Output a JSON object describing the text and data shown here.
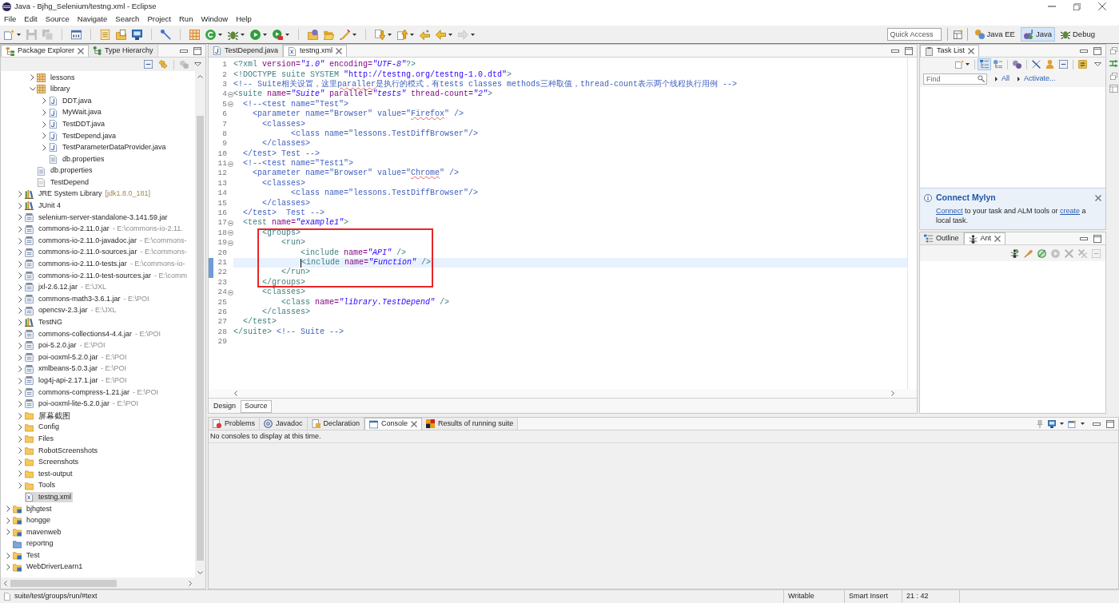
{
  "window": {
    "title": "Java - Bjhg_Selenium/testng.xml - Eclipse"
  },
  "menu": [
    "File",
    "Edit",
    "Source",
    "Navigate",
    "Search",
    "Project",
    "Run",
    "Window",
    "Help"
  ],
  "toolbar": {
    "groups": [
      [
        {
          "kind": "new",
          "dropdown": true,
          "disabled": false
        },
        {
          "kind": "save",
          "dropdown": false,
          "disabled": true
        },
        {
          "kind": "save-all",
          "dropdown": false,
          "disabled": true
        }
      ],
      [
        {
          "kind": "binary",
          "dropdown": false,
          "disabled": false
        }
      ],
      [
        {
          "kind": "list",
          "dropdown": false,
          "disabled": false
        },
        {
          "kind": "note",
          "dropdown": false,
          "disabled": false
        },
        {
          "kind": "monitor",
          "dropdown": false,
          "disabled": false
        }
      ],
      [
        {
          "kind": "slash",
          "dropdown": false,
          "disabled": false
        }
      ],
      [
        {
          "kind": "grid",
          "dropdown": false,
          "disabled": false
        },
        {
          "kind": "cycle",
          "dropdown": true,
          "disabled": false
        },
        {
          "kind": "bug",
          "dropdown": true,
          "disabled": false
        },
        {
          "kind": "run",
          "dropdown": true,
          "disabled": false
        },
        {
          "kind": "run-tool",
          "dropdown": true,
          "disabled": false
        }
      ],
      [
        {
          "kind": "folder-globe",
          "dropdown": false,
          "disabled": false
        },
        {
          "kind": "open-folder",
          "dropdown": false,
          "disabled": false
        },
        {
          "kind": "brush",
          "dropdown": true,
          "disabled": false
        }
      ],
      [
        {
          "kind": "down",
          "dropdown": true,
          "disabled": false
        },
        {
          "kind": "up",
          "dropdown": true,
          "disabled": false
        },
        {
          "kind": "last-edit",
          "dropdown": false,
          "disabled": false
        },
        {
          "kind": "back",
          "dropdown": true,
          "disabled": false
        },
        {
          "kind": "forward",
          "dropdown": true,
          "disabled": true
        }
      ]
    ],
    "quick_access": {
      "placeholder": "Quick Access"
    },
    "perspectives": [
      {
        "kind": "java-ee",
        "label": "Java EE",
        "selected": false
      },
      {
        "kind": "java",
        "label": "Java",
        "selected": true
      },
      {
        "kind": "debug",
        "label": "Debug",
        "selected": false
      }
    ]
  },
  "package_explorer": {
    "tabs": [
      {
        "kind": "explorer",
        "label": "Package Explorer",
        "selected": true
      },
      {
        "kind": "hierarchy",
        "label": "Type Hierarchy",
        "selected": false
      }
    ],
    "tree": [
      {
        "children": [
          {
            "children": [
              {
                "kind": "package",
                "label": "lessons",
                "expanded": false,
                "selected": false
              },
              {
                "kind": "package",
                "label": "library",
                "expanded": true,
                "selected": false,
                "children": [
                  {
                    "kind": "java",
                    "label": "DDT.java",
                    "expanded": false,
                    "selected": false
                  },
                  {
                    "kind": "java",
                    "label": "MyWait.java",
                    "expanded": false,
                    "selected": false
                  },
                  {
                    "kind": "java",
                    "label": "TestDDT.java",
                    "expanded": false,
                    "selected": false
                  },
                  {
                    "kind": "java",
                    "label": "TestDepend.java",
                    "expanded": false,
                    "selected": false
                  },
                  {
                    "kind": "java",
                    "label": "TestParameterDataProvider.java",
                    "expanded": false,
                    "selected": false
                  },
                  {
                    "kind": "properties",
                    "label": "db.properties",
                    "selected": false
                  }
                ]
              },
              {
                "kind": "properties",
                "label": "db.properties",
                "selected": false
              },
              {
                "kind": "file",
                "label": "TestDepend",
                "selected": false
              }
            ]
          },
          {
            "kind": "library",
            "label": "JRE System Library",
            "qualifier": "[jdk1.8.0_181]",
            "expanded": false,
            "selected": false
          },
          {
            "kind": "library",
            "label": "JUnit 4",
            "expanded": false,
            "selected": false
          },
          {
            "kind": "jar",
            "label": "selenium-server-standalone-3.141.59.jar",
            "expanded": false,
            "selected": false
          },
          {
            "kind": "jar",
            "label": "commons-io-2.11.0.jar",
            "detail": "- E:\\commons-io-2.11.",
            "expanded": false,
            "selected": false
          },
          {
            "kind": "jar",
            "label": "commons-io-2.11.0-javadoc.jar",
            "detail": "- E:\\commons-",
            "expanded": false,
            "selected": false
          },
          {
            "kind": "jar",
            "label": "commons-io-2.11.0-sources.jar",
            "detail": "- E:\\commons-",
            "expanded": false,
            "selected": false
          },
          {
            "kind": "jar",
            "label": "commons-io-2.11.0-tests.jar",
            "detail": "- E:\\commons-io-",
            "expanded": false,
            "selected": false
          },
          {
            "kind": "jar",
            "label": "commons-io-2.11.0-test-sources.jar",
            "detail": "- E:\\comm",
            "expanded": false,
            "selected": false
          },
          {
            "kind": "jar",
            "label": "jxl-2.6.12.jar",
            "detail": "- E:\\JXL",
            "expanded": false,
            "selected": false
          },
          {
            "kind": "jar",
            "label": "commons-math3-3.6.1.jar",
            "detail": "- E:\\POI",
            "expanded": false,
            "selected": false
          },
          {
            "kind": "jar",
            "label": "opencsv-2.3.jar",
            "detail": "- E:\\JXL",
            "expanded": false,
            "selected": false
          },
          {
            "kind": "library",
            "label": "TestNG",
            "expanded": false,
            "selected": false
          },
          {
            "kind": "jar",
            "label": "commons-collections4-4.4.jar",
            "detail": "- E:\\POI",
            "expanded": false,
            "selected": false
          },
          {
            "kind": "jar",
            "label": "poi-5.2.0.jar",
            "detail": "- E:\\POI",
            "expanded": false,
            "selected": false
          },
          {
            "kind": "jar",
            "label": "poi-ooxml-5.2.0.jar",
            "detail": "- E:\\POI",
            "expanded": false,
            "selected": false
          },
          {
            "kind": "jar",
            "label": "xmlbeans-5.0.3.jar",
            "detail": "- E:\\POI",
            "expanded": false,
            "selected": false
          },
          {
            "kind": "jar",
            "label": "log4j-api-2.17.1.jar",
            "detail": "- E:\\POI",
            "expanded": false,
            "selected": false
          },
          {
            "kind": "jar",
            "label": "commons-compress-1.21.jar",
            "detail": "- E:\\POI",
            "expanded": false,
            "selected": false
          },
          {
            "kind": "jar",
            "label": "poi-ooxml-lite-5.2.0.jar",
            "detail": "- E:\\POI",
            "expanded": false,
            "selected": false
          },
          {
            "kind": "folder",
            "label": "屏幕截图",
            "expanded": false,
            "selected": false
          },
          {
            "kind": "folder",
            "label": "Config",
            "expanded": false,
            "selected": false
          },
          {
            "kind": "folder",
            "label": "Files",
            "expanded": false,
            "selected": false
          },
          {
            "kind": "folder",
            "label": "RobotScreenshots",
            "expanded": false,
            "selected": false
          },
          {
            "kind": "folder",
            "label": "Screenshots",
            "expanded": false,
            "selected": false
          },
          {
            "kind": "folder",
            "label": "test-output",
            "expanded": false,
            "selected": false
          },
          {
            "kind": "folder",
            "label": "Tools",
            "expanded": false,
            "selected": false
          },
          {
            "kind": "xml",
            "label": "testng.xml",
            "selected": true
          }
        ]
      },
      {
        "kind": "project",
        "label": "bjhgtest",
        "expanded": false,
        "selected": false
      },
      {
        "kind": "project",
        "label": "hongge",
        "expanded": false,
        "selected": false
      },
      {
        "kind": "project",
        "label": "mavenweb",
        "expanded": false,
        "selected": false
      },
      {
        "kind": "closed-project",
        "label": "reportng",
        "selected": false
      },
      {
        "kind": "project",
        "label": "Test",
        "expanded": false,
        "selected": false
      },
      {
        "kind": "project",
        "label": "WebDriverLearn1",
        "expanded": false,
        "selected": false
      }
    ]
  },
  "editor": {
    "tabs": [
      {
        "kind": "java",
        "label": "TestDepend.java",
        "selected": false
      },
      {
        "kind": "xml",
        "label": "testng.xml",
        "selected": true
      }
    ],
    "sections": [
      {
        "boxed": false,
        "lines": [
          {
            "number": "1",
            "fold": false,
            "changed": false,
            "current": false,
            "tokens": [
              {
                "text": "<?xml ",
                "kind": "tag"
              },
              {
                "text": "version=",
                "kind": "attr"
              },
              {
                "text": "\"1.0\"",
                "kind": "value"
              },
              {
                "text": " encoding=",
                "kind": "attr"
              },
              {
                "text": "\"UTF-8\"",
                "kind": "value"
              },
              {
                "text": "?>",
                "kind": "tag"
              }
            ]
          },
          {
            "number": "2",
            "fold": false,
            "changed": false,
            "current": false,
            "tokens": [
              {
                "text": "<!DOCTYPE suite SYSTEM ",
                "kind": "tag"
              },
              {
                "text": "\"http://testng.org/testng-1.0.dtd\"",
                "kind": "string"
              },
              {
                "text": ">",
                "kind": "tag"
              }
            ]
          },
          {
            "number": "3",
            "fold": false,
            "changed": false,
            "current": false,
            "tokens": [
              {
                "text": "<!-- Suite相关设置，这里",
                "kind": "comment"
              },
              {
                "text": "paraller",
                "kind": "typo"
              },
              {
                "text": "是执行的模式，有tests classes methods三种取值，thread-count表示两个线程执行用例 -->",
                "kind": "comment"
              }
            ]
          },
          {
            "number": "4",
            "fold": true,
            "changed": false,
            "current": false,
            "tokens": [
              {
                "text": "<suite ",
                "kind": "tag"
              },
              {
                "text": "name=",
                "kind": "attr"
              },
              {
                "text": "\"Suite\"",
                "kind": "value"
              },
              {
                "text": " parallel=",
                "kind": "attr"
              },
              {
                "text": "\"tests\"",
                "kind": "value"
              },
              {
                "text": " thread-count=",
                "kind": "attr"
              },
              {
                "text": "\"2\"",
                "kind": "value"
              },
              {
                "text": ">",
                "kind": "tag"
              }
            ]
          },
          {
            "number": "5",
            "fold": true,
            "changed": false,
            "current": false,
            "tokens": [
              {
                "text": "  <!--<test name=\"Test\">",
                "kind": "comment"
              }
            ]
          },
          {
            "number": "6",
            "fold": false,
            "changed": false,
            "current": false,
            "tokens": [
              {
                "text": "    <parameter name=\"Browser\" value=\"",
                "kind": "comment"
              },
              {
                "text": "Firefox",
                "kind": "typo"
              },
              {
                "text": "\" />",
                "kind": "comment"
              }
            ]
          },
          {
            "number": "7",
            "fold": false,
            "changed": false,
            "current": false,
            "tokens": [
              {
                "text": "      <classes>",
                "kind": "comment"
              }
            ]
          },
          {
            "number": "8",
            "fold": false,
            "changed": false,
            "current": false,
            "tokens": [
              {
                "text": "            <class name=\"lessons.TestDiffBrowser\"/>",
                "kind": "comment"
              }
            ]
          },
          {
            "number": "9",
            "fold": false,
            "changed": false,
            "current": false,
            "tokens": [
              {
                "text": "      </classes>",
                "kind": "comment"
              }
            ]
          },
          {
            "number": "10",
            "fold": false,
            "changed": false,
            "current": false,
            "tokens": [
              {
                "text": "  </test> Test -->",
                "kind": "comment"
              }
            ]
          },
          {
            "number": "11",
            "fold": true,
            "changed": false,
            "current": false,
            "tokens": [
              {
                "text": "  <!--<test name=\"Test1\">",
                "kind": "comment"
              }
            ]
          },
          {
            "number": "12",
            "fold": false,
            "changed": false,
            "current": false,
            "tokens": [
              {
                "text": "    <parameter name=\"Browser\" value=\"",
                "kind": "comment"
              },
              {
                "text": "Chrome",
                "kind": "typo"
              },
              {
                "text": "\" />",
                "kind": "comment"
              }
            ]
          },
          {
            "number": "13",
            "fold": false,
            "changed": false,
            "current": false,
            "tokens": [
              {
                "text": "      <classes>",
                "kind": "comment"
              }
            ]
          },
          {
            "number": "14",
            "fold": false,
            "changed": false,
            "current": false,
            "tokens": [
              {
                "text": "            <class name=\"lessons.TestDiffBrowser\"/>",
                "kind": "comment"
              }
            ]
          },
          {
            "number": "15",
            "fold": false,
            "changed": false,
            "current": false,
            "tokens": [
              {
                "text": "      </classes>",
                "kind": "comment"
              }
            ]
          },
          {
            "number": "16",
            "fold": false,
            "changed": false,
            "current": false,
            "tokens": [
              {
                "text": "  </test>  Test -->",
                "kind": "comment"
              }
            ]
          },
          {
            "number": "17",
            "fold": true,
            "changed": false,
            "current": false,
            "tokens": [
              {
                "text": "  <test ",
                "kind": "tag"
              },
              {
                "text": "name=",
                "kind": "attr"
              },
              {
                "text": "\"example1\"",
                "kind": "value"
              },
              {
                "text": ">",
                "kind": "tag"
              }
            ]
          }
        ]
      },
      {
        "boxed": true,
        "lines": [
          {
            "number": "18",
            "fold": true,
            "changed": false,
            "current": false,
            "tokens": [
              {
                "text": "      <groups>",
                "kind": "tag"
              }
            ]
          },
          {
            "number": "19",
            "fold": true,
            "changed": false,
            "current": false,
            "tokens": [
              {
                "text": "          <run>",
                "kind": "tag"
              }
            ]
          },
          {
            "number": "20",
            "fold": false,
            "changed": false,
            "current": false,
            "tokens": [
              {
                "text": "              <include ",
                "kind": "tag"
              },
              {
                "text": "name=",
                "kind": "attr"
              },
              {
                "text": "\"API\"",
                "kind": "value"
              },
              {
                "text": " />",
                "kind": "tag"
              }
            ]
          },
          {
            "number": "21",
            "fold": false,
            "changed": true,
            "current": true,
            "tokens": [
              {
                "text": "              <include ",
                "kind": "tag"
              },
              {
                "text": "name=",
                "kind": "attr"
              },
              {
                "text": "\"Function\"",
                "kind": "value"
              },
              {
                "text": " />",
                "kind": "tag"
              }
            ]
          },
          {
            "number": "22",
            "fold": false,
            "changed": true,
            "current": false,
            "tokens": [
              {
                "text": "          </run>",
                "kind": "tag"
              }
            ]
          },
          {
            "number": "23",
            "fold": false,
            "changed": false,
            "current": false,
            "tokens": [
              {
                "text": "      </groups>",
                "kind": "tag"
              }
            ]
          }
        ]
      },
      {
        "boxed": false,
        "lines": [
          {
            "number": "24",
            "fold": true,
            "changed": false,
            "current": false,
            "tokens": [
              {
                "text": "      <classes>",
                "kind": "tag"
              }
            ]
          },
          {
            "number": "25",
            "fold": false,
            "changed": false,
            "current": false,
            "tokens": [
              {
                "text": "          <class ",
                "kind": "tag"
              },
              {
                "text": "name=",
                "kind": "attr"
              },
              {
                "text": "\"library.TestDepend\"",
                "kind": "value"
              },
              {
                "text": " />",
                "kind": "tag"
              }
            ]
          },
          {
            "number": "26",
            "fold": false,
            "changed": false,
            "current": false,
            "tokens": [
              {
                "text": "      </classes>",
                "kind": "tag"
              }
            ]
          },
          {
            "number": "27",
            "fold": false,
            "changed": false,
            "current": false,
            "tokens": [
              {
                "text": "  </test>",
                "kind": "tag"
              }
            ]
          },
          {
            "number": "28",
            "fold": false,
            "changed": false,
            "current": false,
            "tokens": [
              {
                "text": "</suite> ",
                "kind": "tag"
              },
              {
                "text": "<!-- Suite -->",
                "kind": "comment"
              }
            ]
          },
          {
            "number": "29",
            "fold": false,
            "changed": false,
            "current": false
          }
        ]
      }
    ],
    "bottom_tabs": [
      {
        "label": "Design",
        "selected": false
      },
      {
        "label": "Source",
        "selected": true
      }
    ]
  },
  "task_list": {
    "tabs": [
      {
        "kind": "task",
        "label": "Task List",
        "selected": true
      }
    ],
    "toolbar": [
      [
        {
          "kind": "new-task",
          "dropdown": true,
          "pressed": false
        }
      ],
      [
        {
          "kind": "categorized",
          "dropdown": false,
          "pressed": true
        },
        {
          "kind": "scheduled",
          "dropdown": false,
          "pressed": false
        }
      ],
      [
        {
          "kind": "focus",
          "dropdown": false,
          "pressed": false
        }
      ],
      [
        {
          "kind": "hide-completed",
          "dropdown": false,
          "pressed": false
        },
        {
          "kind": "person-filter",
          "dropdown": false,
          "pressed": false
        },
        {
          "kind": "collapse",
          "dropdown": false,
          "pressed": false
        }
      ],
      [
        {
          "kind": "sync",
          "dropdown": false,
          "pressed": false
        }
      ]
    ],
    "find": {
      "placeholder": "Find"
    },
    "filters": [
      "All",
      "Activate..."
    ],
    "mylyn": {
      "title": "Connect Mylyn",
      "message": [
        {
          "kind": "link",
          "text": "Connect"
        },
        {
          "kind": "text",
          "text": " to your task and ALM tools or "
        },
        {
          "kind": "link",
          "text": "create"
        },
        {
          "kind": "text",
          "text": " a local task."
        }
      ]
    }
  },
  "ant_view": {
    "tabs": [
      {
        "kind": "outline",
        "label": "Outline",
        "selected": false
      },
      {
        "kind": "ant",
        "label": "Ant",
        "selected": true
      }
    ],
    "toolbar": [
      {
        "kind": "add-buildfile",
        "disabled": false
      },
      {
        "kind": "search-buildfile",
        "disabled": false
      },
      {
        "kind": "hide-internal",
        "disabled": false
      },
      {
        "kind": "run",
        "disabled": true
      },
      {
        "kind": "remove",
        "disabled": true
      },
      {
        "kind": "remove-all",
        "disabled": true
      },
      {
        "kind": "collapse",
        "disabled": true
      }
    ]
  },
  "console_view": {
    "tabs": [
      {
        "kind": "problems",
        "label": "Problems",
        "selected": false
      },
      {
        "kind": "javadoc",
        "label": "Javadoc",
        "selected": false
      },
      {
        "kind": "declaration",
        "label": "Declaration",
        "selected": false
      },
      {
        "kind": "console",
        "label": "Console",
        "selected": true
      },
      {
        "kind": "results",
        "label": "Results of running suite",
        "selected": false
      }
    ],
    "message": "No consoles to display at this time."
  },
  "status_bar": {
    "path": "suite/test/groups/run/#text",
    "fields": [
      "Writable",
      "Smart Insert",
      "21 : 42"
    ]
  }
}
